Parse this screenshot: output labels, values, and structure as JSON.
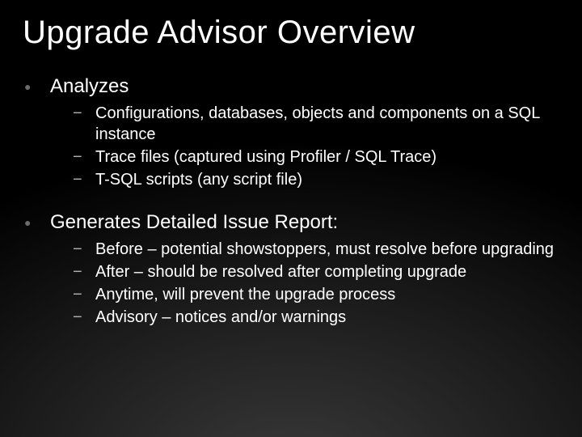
{
  "title": "Upgrade Advisor Overview",
  "sections": [
    {
      "heading": "Analyzes",
      "items": [
        "Configurations, databases, objects and components on a SQL instance",
        "Trace files (captured using Profiler / SQL Trace)",
        "T-SQL scripts (any script file)"
      ]
    },
    {
      "heading": "Generates Detailed Issue Report:",
      "items": [
        "Before – potential showstoppers, must resolve before upgrading",
        "After – should be resolved after completing upgrade",
        "Anytime, will prevent the upgrade process",
        "Advisory – notices and/or warnings"
      ]
    }
  ]
}
